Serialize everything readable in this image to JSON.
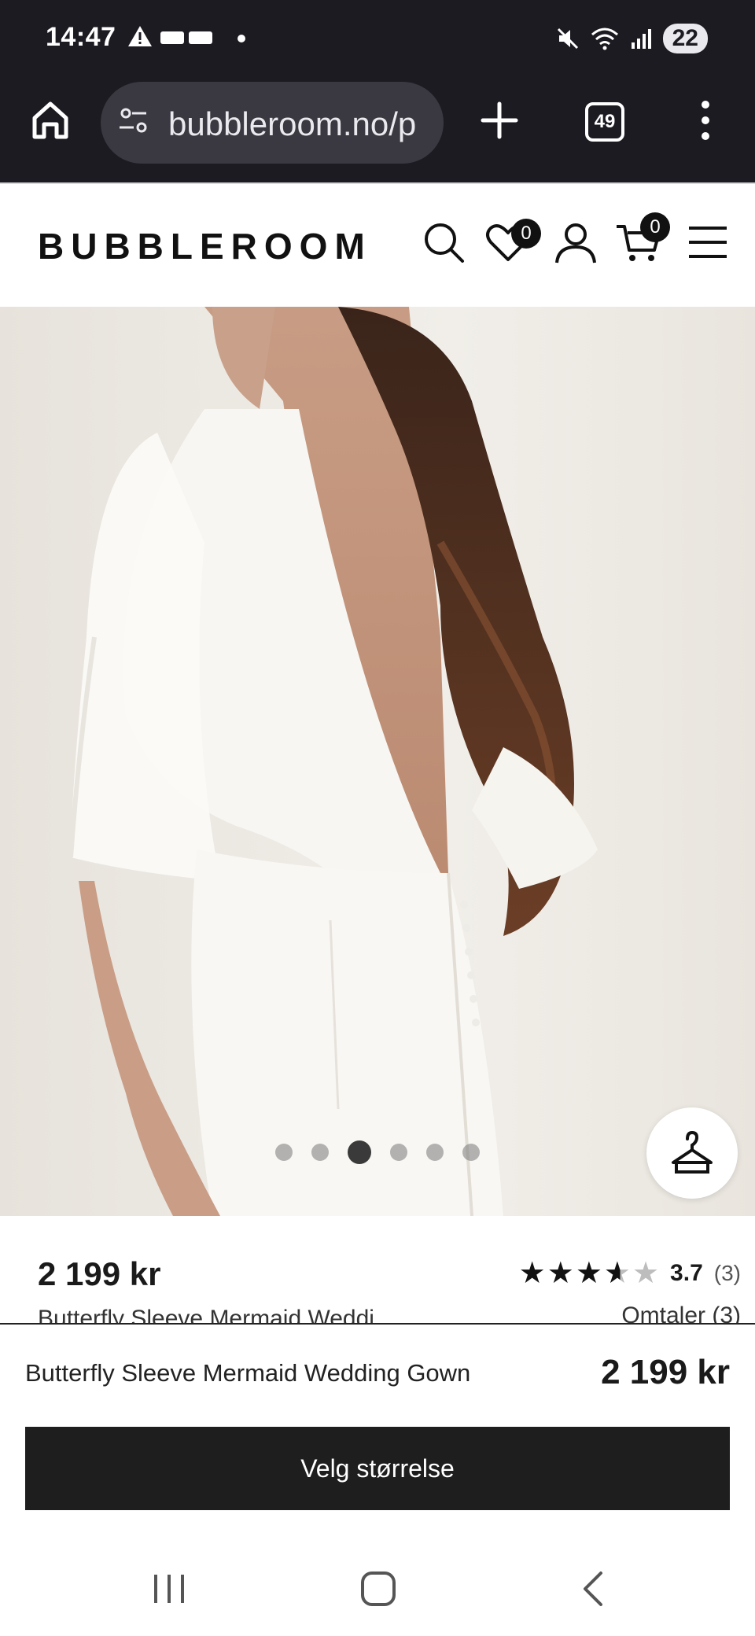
{
  "status_bar": {
    "time": "14:47",
    "battery": "22"
  },
  "browser": {
    "url": "bubbleroom.no/p",
    "tab_count": "49"
  },
  "site": {
    "logo": "BUBBLEROOM",
    "wishlist_count": "0",
    "cart_count": "0"
  },
  "gallery": {
    "image_count": 6,
    "active_index": 2
  },
  "product": {
    "price": "2 199 kr",
    "rating": 3.7,
    "rating_label": "3.7",
    "rating_count": "(3)",
    "reviews_link": "Omtaler (3)",
    "title_partial": "Butterfly Sleeve Mermaid Weddi..."
  },
  "sticky_bar": {
    "title": "Butterfly Sleeve Mermaid Wedding Gown",
    "price": "2 199 kr",
    "cta": "Velg størrelse"
  },
  "icons": {
    "home": "home-icon",
    "site_info": "site-info-icon",
    "new_tab": "plus-icon",
    "more": "more-vertical-icon",
    "search": "search-icon",
    "wishlist": "heart-icon",
    "account": "user-icon",
    "cart": "cart-icon",
    "menu": "hamburger-icon",
    "fit": "hanger-icon"
  }
}
